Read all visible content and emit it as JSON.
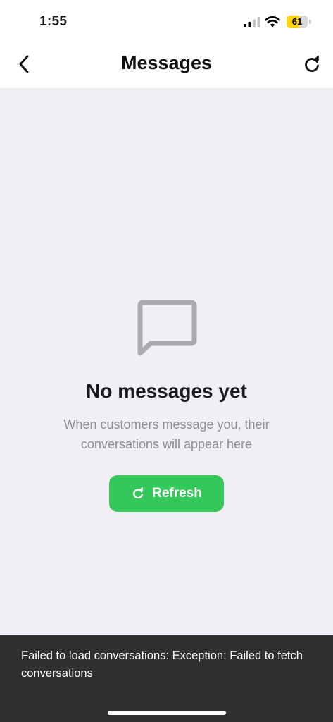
{
  "status_bar": {
    "time": "1:55",
    "battery_level": "61",
    "battery_fraction": 0.61,
    "battery_color": "#ffd60a",
    "signal_icon": "cellular-signal-icon",
    "wifi_icon": "wifi-icon"
  },
  "nav": {
    "title": "Messages",
    "back_icon": "chevron-left-icon",
    "refresh_icon": "refresh-icon"
  },
  "empty_state": {
    "icon": "message-bubble-icon",
    "title": "No messages yet",
    "subtitle": "When customers message you, their conversations will appear here",
    "button_label": "Refresh",
    "button_color": "#34c759"
  },
  "snackbar": {
    "message": "Failed to load conversations: Exception: Failed to fetch conversations"
  }
}
